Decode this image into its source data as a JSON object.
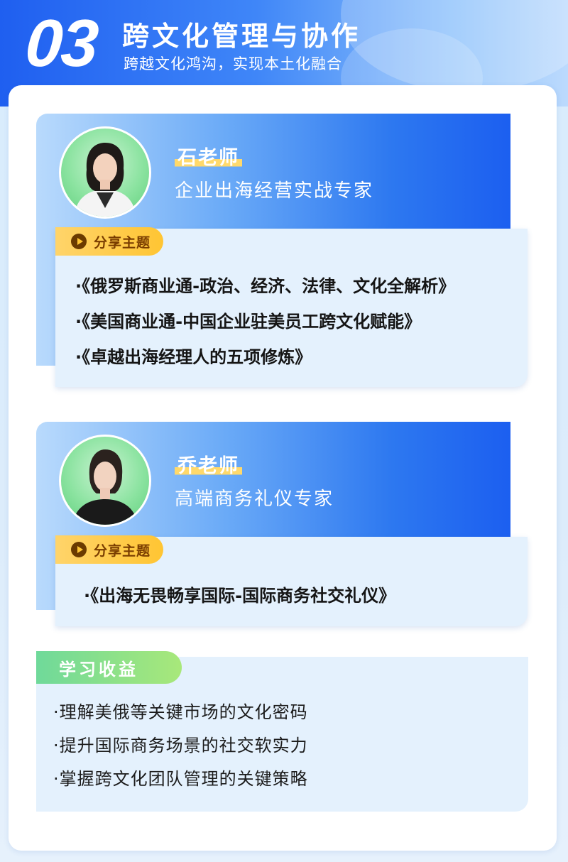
{
  "header": {
    "section_number": "03",
    "title": "跨文化管理与协作",
    "subtitle": "跨越文化鸿沟，实现本土化融合"
  },
  "teachers": [
    {
      "name": "石老师",
      "role": "企业出海经营实战专家",
      "tag_label": "分享主题",
      "topics": [
        "·《俄罗斯商业通-政治、经济、法律、文化全解析》",
        "·《美国商业通-中国企业驻美员工跨文化赋能》",
        "·《卓越出海经理人的五项修炼》"
      ]
    },
    {
      "name": "乔老师",
      "role": "高端商务礼仪专家",
      "tag_label": "分享主题",
      "topics": [
        "·《出海无畏畅享国际-国际商务社交礼仪》"
      ]
    }
  ],
  "benefits": {
    "label": "学习收益",
    "items": [
      "·理解美俄等关键市场的文化密码",
      "·提升国际商务场景的社交软实力",
      "·掌握跨文化团队管理的关键策略"
    ]
  },
  "colors": {
    "brand_blue": "#1f5ff0",
    "tag_yellow": "#ffc533",
    "benefit_green": "#6fd99a",
    "card_bg": "#e4f1fd"
  }
}
